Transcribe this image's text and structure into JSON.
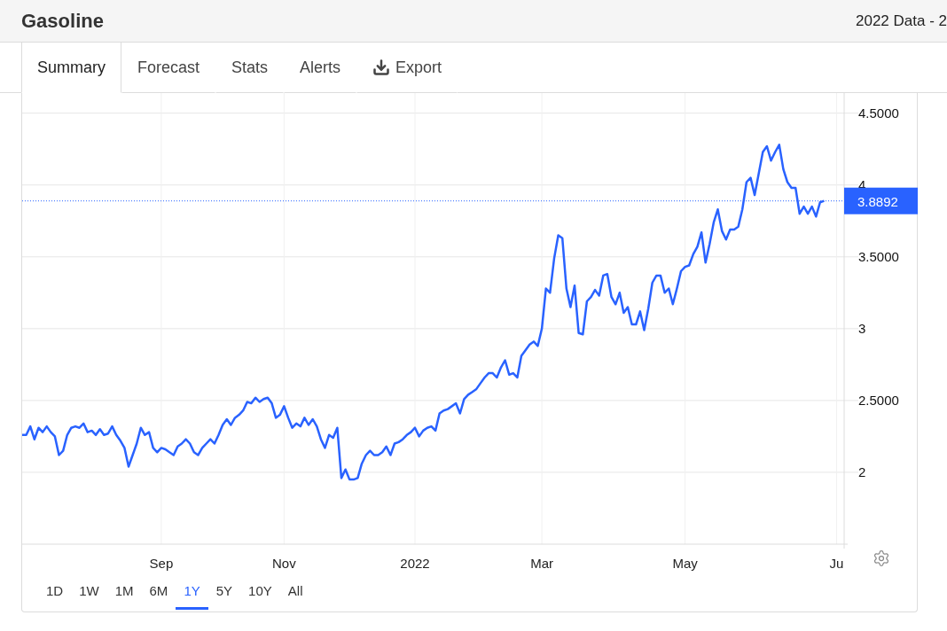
{
  "header": {
    "title": "Gasoline",
    "subtitle": "2022 Data - 2"
  },
  "tabs": [
    {
      "label": "Summary",
      "selected": true,
      "kind": "text"
    },
    {
      "label": "Forecast",
      "selected": false,
      "kind": "text"
    },
    {
      "label": "Stats",
      "selected": false,
      "kind": "text"
    },
    {
      "label": "Alerts",
      "selected": false,
      "kind": "text"
    },
    {
      "label": "Export",
      "selected": false,
      "kind": "download"
    }
  ],
  "chart": {
    "chart_data": {
      "type": "line",
      "ylim": [
        1.5,
        4.64
      ],
      "categories": [
        null,
        null,
        null,
        null,
        null,
        null,
        null,
        null,
        null,
        null,
        null,
        null,
        null,
        null,
        null,
        null,
        null,
        null,
        null,
        null,
        null,
        null,
        null,
        null,
        null,
        null,
        null,
        null,
        null,
        null,
        null,
        null,
        null,
        null,
        "Sep",
        null,
        null,
        null,
        null,
        null,
        null,
        null,
        null,
        null,
        null,
        null,
        null,
        null,
        null,
        null,
        null,
        null,
        null,
        null,
        null,
        null,
        null,
        null,
        null,
        null,
        null,
        null,
        null,
        null,
        "Nov",
        null,
        null,
        null,
        null,
        null,
        null,
        null,
        null,
        null,
        null,
        null,
        null,
        null,
        null,
        null,
        null,
        null,
        null,
        null,
        null,
        null,
        null,
        null,
        null,
        null,
        null,
        null,
        null,
        null,
        null,
        null,
        "2022",
        null,
        null,
        null,
        null,
        null,
        null,
        null,
        null,
        null,
        null,
        null,
        null,
        null,
        null,
        null,
        null,
        null,
        null,
        null,
        null,
        null,
        null,
        null,
        null,
        null,
        null,
        null,
        null,
        null,
        null,
        "Mar",
        null,
        null,
        null,
        null,
        null,
        null,
        null,
        null,
        null,
        null,
        null,
        null,
        null,
        null,
        null,
        null,
        null,
        null,
        null,
        null,
        null,
        null,
        null,
        null,
        null,
        null,
        null,
        null,
        null,
        null,
        null,
        null,
        null,
        null,
        "May",
        null,
        null,
        null,
        null,
        null,
        null,
        null,
        null,
        null,
        null,
        null,
        null,
        null,
        null,
        null,
        null,
        null,
        null,
        null,
        null,
        null,
        null,
        null,
        null,
        null,
        null,
        null,
        null,
        null,
        null,
        null,
        null,
        null,
        null,
        null,
        null,
        "Ju",
        null
      ],
      "yticks": [
        {
          "value": 2,
          "label": "2"
        },
        {
          "value": 2.5,
          "label": "2.5000"
        },
        {
          "value": 3,
          "label": "3"
        },
        {
          "value": 3.5,
          "label": "3.5000"
        },
        {
          "value": 4,
          "label": "4"
        },
        {
          "value": 4.5,
          "label": "4.5000"
        }
      ],
      "series": [
        {
          "color": "#2962ff",
          "values": [
            2.26,
            2.26,
            2.32,
            2.23,
            2.31,
            2.28,
            2.32,
            2.28,
            2.25,
            2.12,
            2.15,
            2.26,
            2.31,
            2.32,
            2.31,
            2.34,
            2.28,
            2.29,
            2.26,
            2.3,
            2.26,
            2.27,
            2.32,
            2.26,
            2.22,
            2.17,
            2.04,
            2.12,
            2.2,
            2.31,
            2.26,
            2.28,
            2.17,
            2.14,
            2.17,
            2.16,
            2.14,
            2.12,
            2.18,
            2.2,
            2.23,
            2.2,
            2.14,
            2.12,
            2.17,
            2.2,
            2.23,
            2.2,
            2.26,
            2.33,
            2.37,
            2.33,
            2.38,
            2.4,
            2.43,
            2.49,
            2.48,
            2.52,
            2.49,
            2.51,
            2.52,
            2.48,
            2.38,
            2.4,
            2.46,
            2.38,
            2.31,
            2.34,
            2.32,
            2.38,
            2.33,
            2.37,
            2.32,
            2.23,
            2.17,
            2.26,
            2.24,
            2.31,
            1.96,
            2.02,
            1.95,
            1.95,
            1.96,
            2.06,
            2.12,
            2.15,
            2.12,
            2.12,
            2.14,
            2.18,
            2.12,
            2.2,
            2.21,
            2.23,
            2.26,
            2.28,
            2.31,
            2.25,
            2.29,
            2.31,
            2.32,
            2.29,
            2.41,
            2.43,
            2.44,
            2.46,
            2.48,
            2.41,
            2.51,
            2.54,
            2.56,
            2.58,
            2.62,
            2.66,
            2.69,
            2.69,
            2.66,
            2.73,
            2.78,
            2.68,
            2.69,
            2.66,
            2.81,
            2.85,
            2.89,
            2.91,
            2.88,
            3.0,
            3.28,
            3.25,
            3.49,
            3.65,
            3.63,
            3.28,
            3.15,
            3.3,
            2.97,
            2.96,
            3.19,
            3.22,
            3.27,
            3.23,
            3.37,
            3.38,
            3.22,
            3.17,
            3.25,
            3.11,
            3.15,
            3.03,
            3.03,
            3.12,
            2.99,
            3.14,
            3.32,
            3.37,
            3.37,
            3.25,
            3.28,
            3.17,
            3.28,
            3.4,
            3.43,
            3.44,
            3.52,
            3.57,
            3.67,
            3.46,
            3.59,
            3.74,
            3.83,
            3.68,
            3.62,
            3.69,
            3.69,
            3.71,
            3.83,
            4.02,
            4.05,
            3.93,
            4.08,
            4.23,
            4.27,
            4.17,
            4.23,
            4.28,
            4.11,
            4.02,
            3.98,
            3.98,
            3.8,
            3.85,
            3.8,
            3.85,
            3.78,
            3.88,
            3.89,
            null,
            null,
            null,
            null
          ]
        }
      ],
      "grid": true,
      "ref_lines": [
        {
          "axis": "y",
          "value": 3.8892,
          "label": "3.8892"
        }
      ]
    }
  },
  "ranges": [
    {
      "label": "1D",
      "selected": false
    },
    {
      "label": "1W",
      "selected": false
    },
    {
      "label": "1M",
      "selected": false
    },
    {
      "label": "6M",
      "selected": false
    },
    {
      "label": "1Y",
      "selected": true
    },
    {
      "label": "5Y",
      "selected": false
    },
    {
      "label": "10Y",
      "selected": false
    },
    {
      "label": "All",
      "selected": false
    }
  ]
}
